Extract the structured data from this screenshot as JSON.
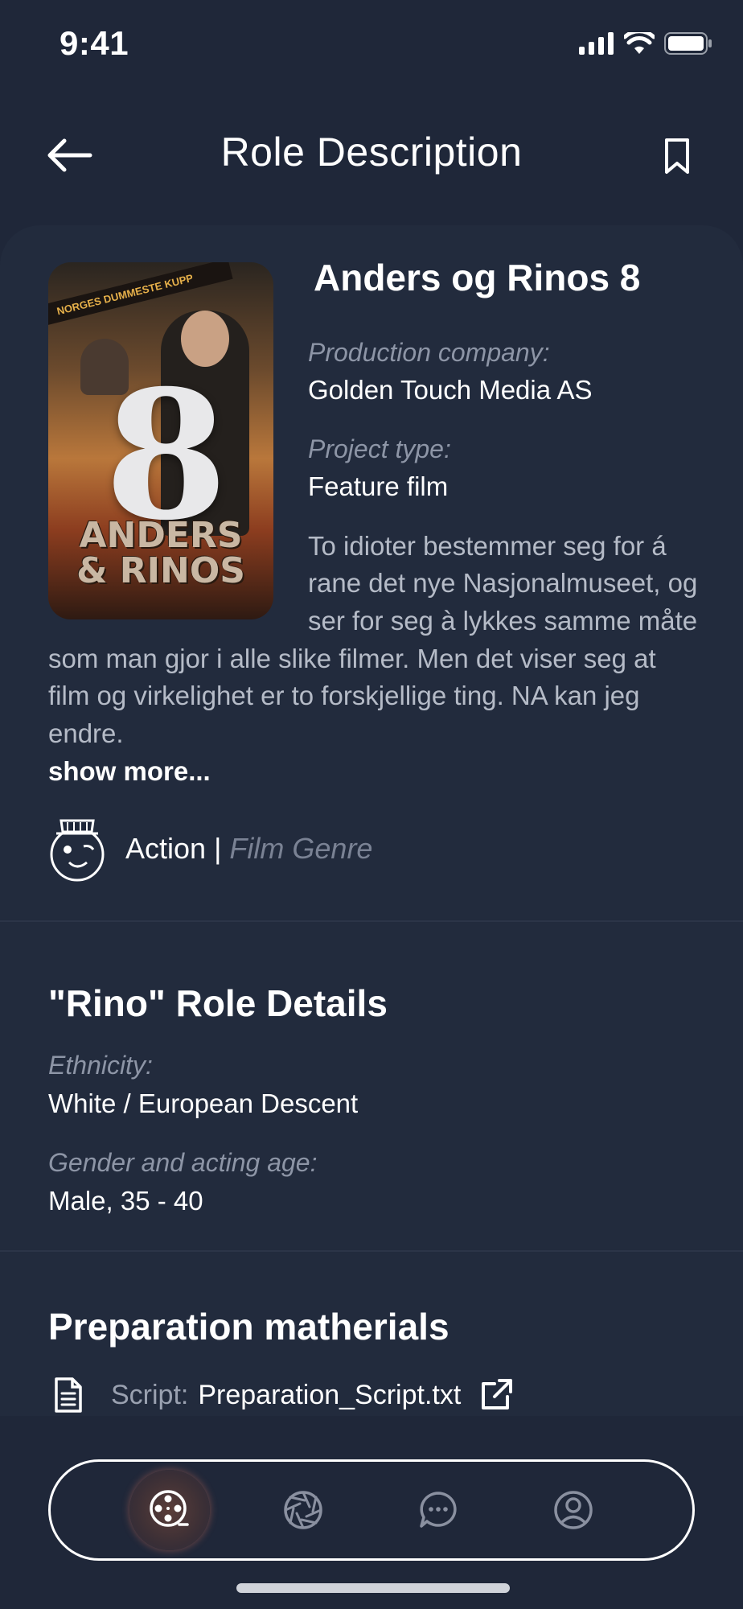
{
  "status_bar": {
    "time": "9:41"
  },
  "header": {
    "title": "Role Description"
  },
  "film": {
    "title": "Anders og Rinos 8",
    "poster": {
      "banner": "NORGES DUMMESTE KUPP",
      "title_line1": "ANDERS",
      "title_line2": "& RINOS",
      "number": "8"
    },
    "production_label": "Production company:",
    "production_value": "Golden Touch Media AS",
    "project_type_label": "Project type:",
    "project_type_value": "Feature film",
    "description_lines": [
      "To idioter bestemmer seg for á",
      "rane det nye Nasjonalmuseet, og",
      "ser for seg à lykkes samme måte",
      "som man gjor i alle slike filmer. Men det viser seg at",
      "film og virkelighet er to forskjellige ting. NA kan jeg",
      "endre."
    ],
    "show_more": "show more...",
    "genre": "Action",
    "genre_separator": " | ",
    "genre_label": "Film Genre"
  },
  "role": {
    "title": "\"Rino\" Role Details",
    "ethnicity_label": "Ethnicity:",
    "ethnicity_value": "White / European Descent",
    "gender_label": "Gender and acting age:",
    "gender_value": "Male, 35 - 40"
  },
  "preparation": {
    "title": "Preparation matherials",
    "script_label": "Script:",
    "script_file": "Preparation_Script.txt"
  },
  "nav": {
    "items": [
      {
        "icon": "film-reel-icon",
        "active": true
      },
      {
        "icon": "aperture-icon",
        "active": false
      },
      {
        "icon": "chat-icon",
        "active": false
      },
      {
        "icon": "profile-icon",
        "active": false
      }
    ]
  },
  "colors": {
    "background": "#1f2739",
    "muted": "#8d95a6",
    "text": "#ffffff"
  }
}
